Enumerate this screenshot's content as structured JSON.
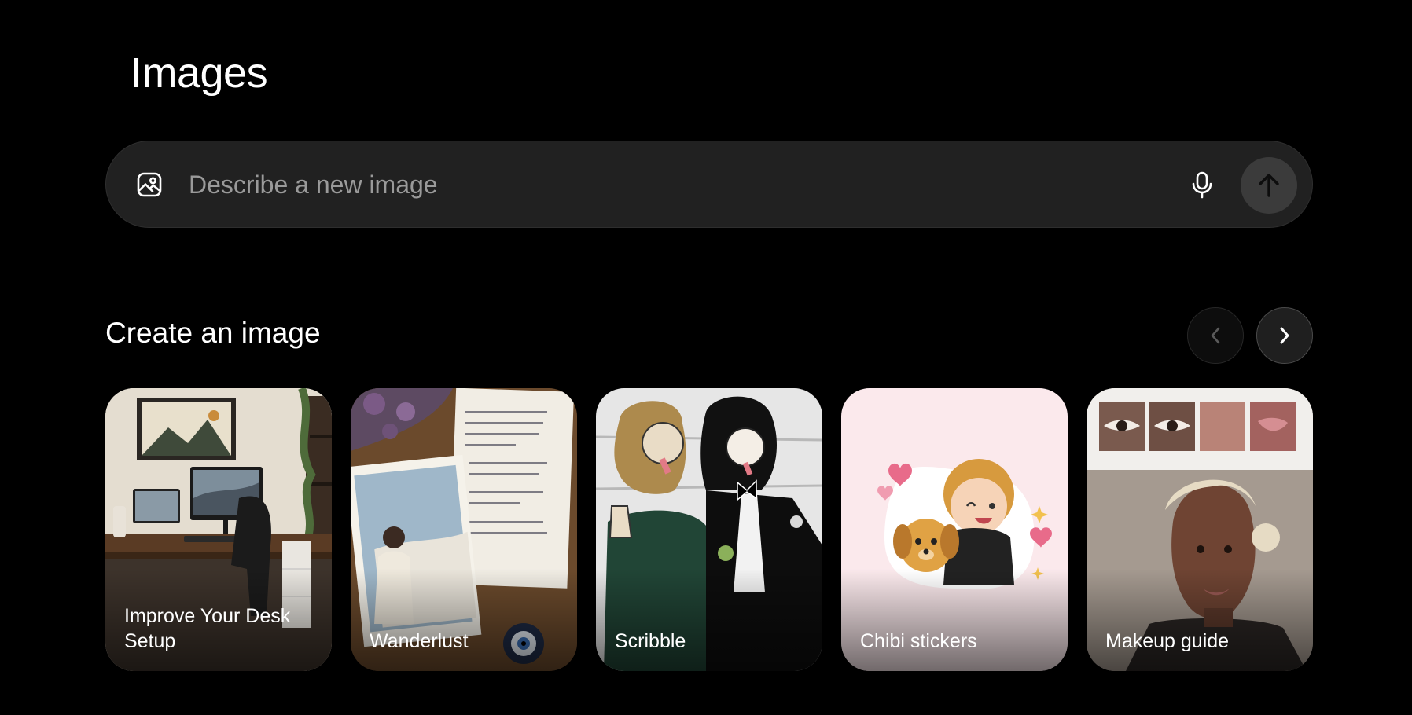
{
  "page": {
    "title": "Images"
  },
  "prompt": {
    "placeholder": "Describe a new image",
    "value": ""
  },
  "section": {
    "title": "Create an image"
  },
  "cards": [
    {
      "label": "Improve Your Desk Setup"
    },
    {
      "label": "Wanderlust"
    },
    {
      "label": "Scribble"
    },
    {
      "label": "Chibi stickers"
    },
    {
      "label": "Makeup guide"
    }
  ],
  "icons": {
    "image": "image-icon",
    "mic": "microphone-icon",
    "send": "arrow-up-icon",
    "prev": "chevron-left-icon",
    "next": "chevron-right-icon"
  },
  "colors": {
    "background": "#000000",
    "prompt_bar": "#212121",
    "send_button": "#3b3b3b",
    "text_primary": "#ffffff",
    "placeholder": "#9a9a9a"
  }
}
